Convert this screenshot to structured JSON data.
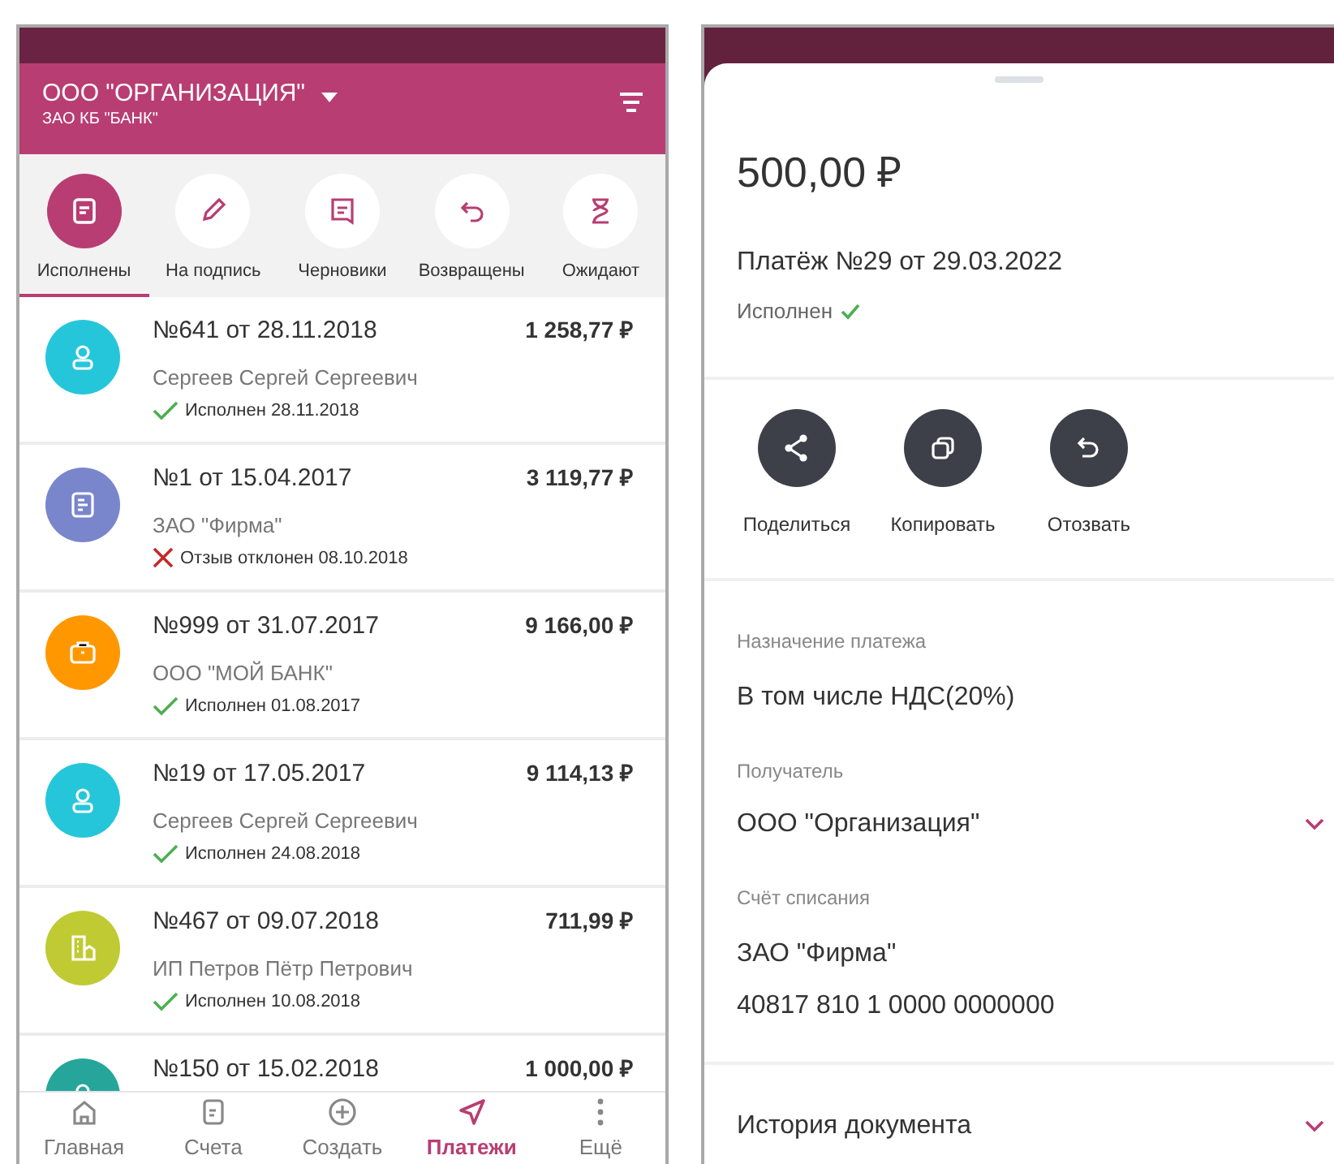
{
  "left_screen": {
    "header": {
      "organization": "ООО \"ОРГАНИЗАЦИЯ\"",
      "bank": "ЗАО КБ \"БАНК\""
    },
    "tabs": [
      {
        "label": "Исполнены",
        "selected": true
      },
      {
        "label": "На подпись",
        "selected": false
      },
      {
        "label": "Черновики",
        "selected": false
      },
      {
        "label": "Возвращены",
        "selected": false
      },
      {
        "label": "Ожидают",
        "selected": false
      }
    ],
    "payments": [
      {
        "kind": "person",
        "color": "#26c6da",
        "number": "№641 от 28.11.2018",
        "amount": "1 258,77 ₽",
        "payee": "Сергеев Сергей Сергеевич",
        "rejected": false,
        "status": "Исполнен 28.11.2018"
      },
      {
        "kind": "document",
        "color": "#7986cb",
        "number": "№1 от 15.04.2017",
        "amount": "3 119,77 ₽",
        "payee": "ЗАО \"Фирма\"",
        "rejected": true,
        "status": "Отзыв отклонен 08.10.2018"
      },
      {
        "kind": "briefcase",
        "color": "#ff9800",
        "number": "№999 от 31.07.2017",
        "amount": "9 166,00 ₽",
        "payee": "ООО \"МОЙ БАНК\"",
        "rejected": false,
        "status": "Исполнен 01.08.2017"
      },
      {
        "kind": "person",
        "color": "#26c6da",
        "number": "№19 от 17.05.2017",
        "amount": "9 114,13 ₽",
        "payee": "Сергеев Сергей Сергеевич",
        "rejected": false,
        "status": "Исполнен 24.08.2018"
      },
      {
        "kind": "building",
        "color": "#c0ca33",
        "number": "№467 от 09.07.2018",
        "amount": "711,99 ₽",
        "payee": "ИП Петров Пётр Петрович",
        "rejected": false,
        "status": "Исполнен 10.08.2018"
      },
      {
        "kind": "person",
        "color": "#26a69a",
        "number": "№150 от 15.02.2018",
        "amount": "1 000,00 ₽"
      }
    ],
    "bottom_nav": [
      {
        "label": "Главная",
        "selected": false
      },
      {
        "label": "Счета",
        "selected": false
      },
      {
        "label": "Создать",
        "selected": false
      },
      {
        "label": "Платежи",
        "selected": true
      },
      {
        "label": "Ещё",
        "selected": false
      }
    ]
  },
  "right_screen": {
    "amount": "500,00 ₽",
    "title": "Платёж №29 от 29.03.2022",
    "status": "Исполнен",
    "actions": [
      {
        "label": "Поделиться"
      },
      {
        "label": "Копировать"
      },
      {
        "label": "Отозвать"
      }
    ],
    "purpose": {
      "label": "Назначение платежа",
      "value": "В том числе НДС(20%)"
    },
    "recipient": {
      "label": "Получатель",
      "value": "ООО \"Организация\""
    },
    "account": {
      "label": "Счёт списания",
      "name": "ЗАО \"Фирма\"",
      "number": "40817 810 1 0000 0000000"
    },
    "history": {
      "label": "История документа"
    }
  }
}
